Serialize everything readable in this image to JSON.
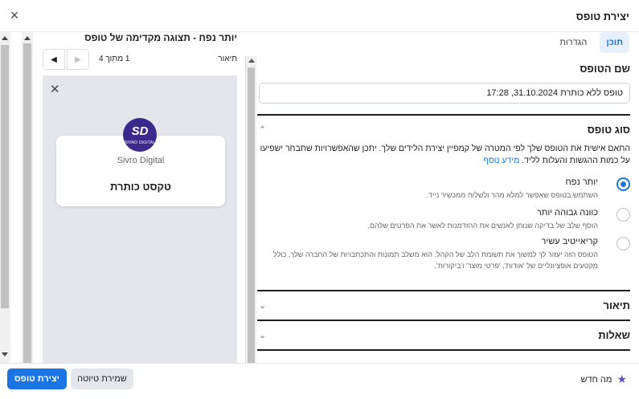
{
  "header": {
    "title": "יצירת טופס",
    "close_icon": "×"
  },
  "tabs": [
    {
      "label": "תוכן",
      "active": true
    },
    {
      "label": "הגדרות",
      "active": false
    }
  ],
  "form": {
    "name_label": "שם הטופס",
    "name_value": "טופס ללא כותרת 31.10.2024, 17:28",
    "type_section": {
      "title": "סוג טופס",
      "description": "התאם אישית את הטופס שלך לפי המטרה של קמפיין יצירת הלידים שלך. יתכן שהאפשרויות שתבחר ישפיעו על כמות ההגשות והעלות לליד.",
      "more_link": "מידע נוסף",
      "options": [
        {
          "title": "יותר נפח",
          "desc": "השתמש בטופס שאפשר למלא מהר ולשלוח ממכשיר נייד.",
          "checked": true
        },
        {
          "title": "כוונה גבוהה יותר",
          "desc": "הוסף שלב של בדיקה שנותן לאנשים את ההזדמנות לאשר את הפרטים שלהם.",
          "checked": false
        },
        {
          "title": "קריאייטיב עשיר",
          "desc": "הטופס הזה יעזור לך למשוך את תשומת הלב של הקהל. הוא משלב תמונות והתכתבויות של החברה שלך, כולל מקטעים אופציונליים של 'אודות', 'פרטי מוצר' ו'ביקורות'.",
          "checked": false
        }
      ]
    },
    "description_section": {
      "title": "תיאור"
    },
    "questions_section": {
      "title": "שאלות"
    }
  },
  "preview": {
    "title": "יותר נפח - תצוגה מקדימה של טופס",
    "pager_label": "תיאור",
    "pager_count": "1 מתוך 4",
    "brand_name": "Sivro Digital",
    "logo_mark": "SD",
    "logo_text": "SIVRO DIGITAL",
    "headline": "טקסט כותרת"
  },
  "footer": {
    "create_button": "יצירת טופס",
    "draft_button": "שמירת טיוטה",
    "whats_new": "מה חדש"
  },
  "icons": {
    "close": "close-icon",
    "chevron": "chevron-icon",
    "star": "star-icon",
    "logo": "sivro-digital-logo"
  },
  "colors": {
    "primary": "#1b74e4",
    "tab_active_bg": "#e7f0fd",
    "logo_bg": "#3b2a8c",
    "star": "#5b4fc4"
  }
}
